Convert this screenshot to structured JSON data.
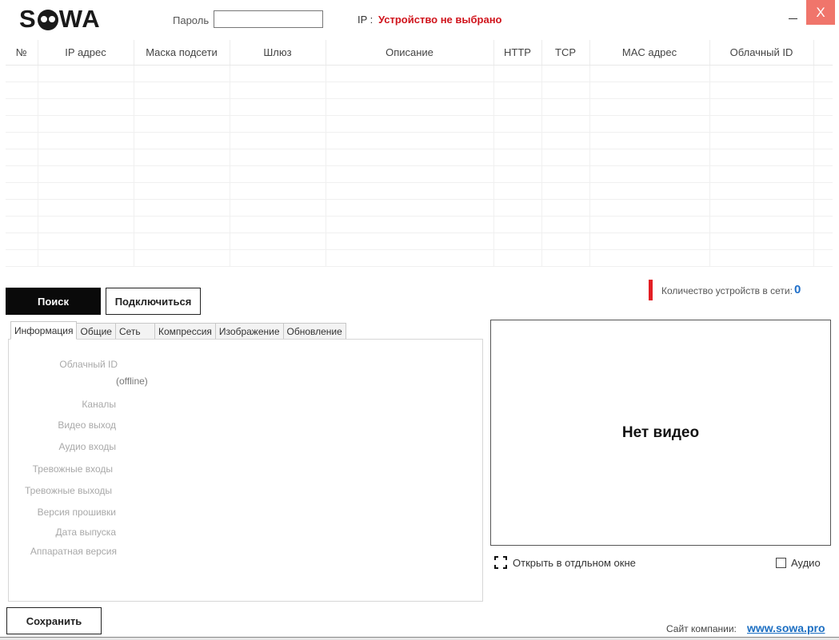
{
  "header": {
    "logo_text": "SOWA",
    "password_label": "Пароль",
    "password_value": "",
    "ip_label": "IP :",
    "ip_status": "Устройство не выбрано",
    "close_glyph": "X"
  },
  "table": {
    "columns": [
      "№",
      "IP адрес",
      "Маска подсети",
      "Шлюз",
      "Описание",
      "HTTP",
      "TCP",
      "MAC адрес",
      "Облачный ID",
      ""
    ]
  },
  "actions": {
    "search_label": "Поиск",
    "connect_label": "Подключиться",
    "device_count_label": "Количество устройств в сети:",
    "device_count": "0"
  },
  "tabs": [
    {
      "label": "Информация"
    },
    {
      "label": "Общие"
    },
    {
      "label": "Сеть"
    },
    {
      "label": "Компрессия"
    },
    {
      "label": "Изображение"
    },
    {
      "label": "Обновление"
    }
  ],
  "info": {
    "cloud_id": "Облачный ID",
    "cloud_status": "(offline)",
    "channels": "Каналы",
    "video_out": "Видео выход",
    "audio_in": "Аудио входы",
    "alarm_in": "Тревожные входы",
    "alarm_out": "Тревожные выходы",
    "firmware": "Версия прошивки",
    "release_date": "Дата выпуска",
    "hardware": "Аппаратная версия"
  },
  "video": {
    "placeholder": "Нет видео",
    "open_window_label": "Открыть в отдльном окне",
    "audio_label": "Аудио",
    "audio_checked": false
  },
  "footer": {
    "save_label": "Сохранить",
    "site_label": "Сайт компании:",
    "site_link": "www.sowa.pro"
  },
  "colors": {
    "accent_red": "#e31e24",
    "status_red": "#d0141c",
    "link_blue": "#1b6ec2",
    "close_bg": "#f0756b"
  }
}
